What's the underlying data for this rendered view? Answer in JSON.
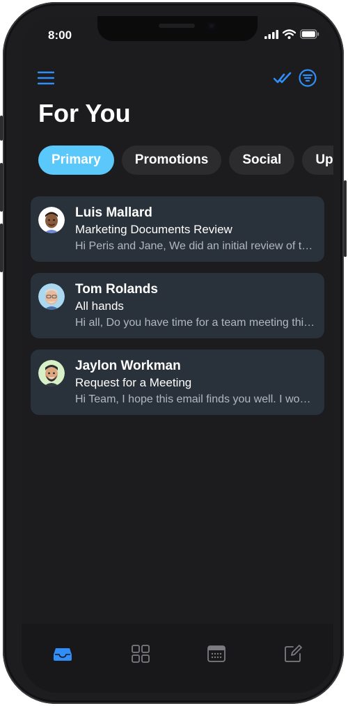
{
  "status_bar": {
    "time": "8:00"
  },
  "header": {
    "title": "For You",
    "menu_icon": "hamburger-menu-icon",
    "mark_read_icon": "double-check-icon",
    "filter_icon": "filter-circle-icon"
  },
  "tabs": [
    {
      "label": "Primary",
      "active": true
    },
    {
      "label": "Promotions",
      "active": false
    },
    {
      "label": "Social",
      "active": false
    },
    {
      "label": "Up",
      "active": false
    }
  ],
  "emails": [
    {
      "sender": "Luis Mallard",
      "subject": "Marketing Documents Review",
      "preview": "Hi Peris and Jane, We did an initial review of the marketing documents",
      "avatar_icon": "memoji-avatar-icon"
    },
    {
      "sender": "Tom Rolands",
      "subject": "All hands",
      "preview": "Hi all, Do you have time for a team meeting this week",
      "avatar_icon": "memoji-avatar-icon"
    },
    {
      "sender": "Jaylon Workman",
      "subject": "Request for a Meeting",
      "preview": "Hi Team, I hope this email finds you well. I would like to schedule",
      "avatar_icon": "memoji-avatar-icon"
    }
  ],
  "bottom_nav": [
    {
      "icon": "inbox-tray-icon",
      "active": true
    },
    {
      "icon": "grid-apps-icon",
      "active": false
    },
    {
      "icon": "calendar-icon",
      "active": false
    },
    {
      "icon": "compose-icon",
      "active": false
    }
  ],
  "colors": {
    "accent": "#2f8ef7",
    "tab_active": "#5ac8fa",
    "card_background": "#29313a",
    "screen_background": "#1c1c1e"
  }
}
